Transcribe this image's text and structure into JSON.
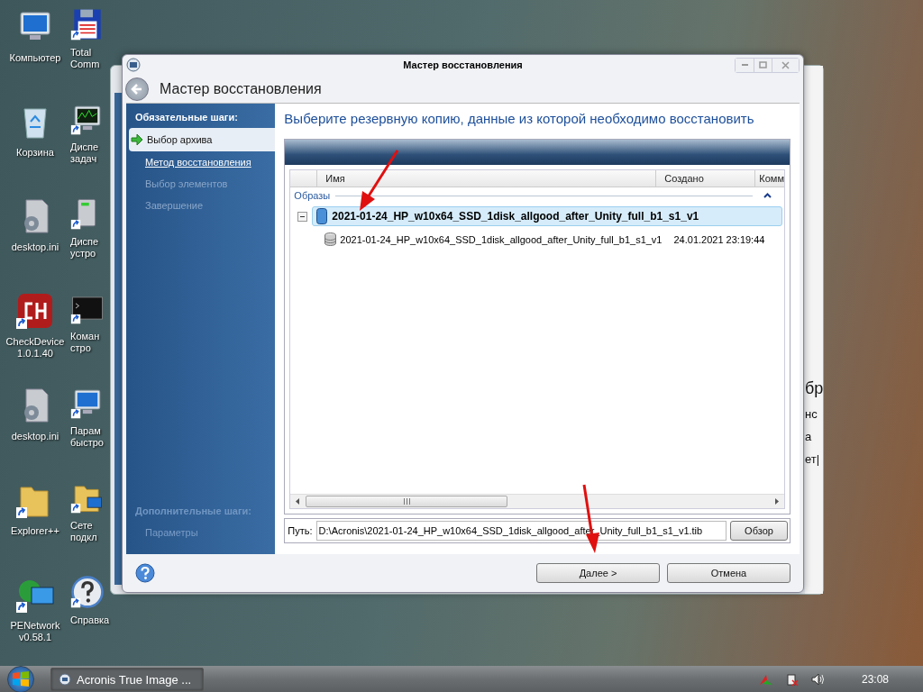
{
  "desktop_columns": [
    {
      "icons": [
        {
          "label": "Компьютер",
          "kind": "computer",
          "shortcut": false
        },
        {
          "label": "Корзина",
          "kind": "recycle-bin",
          "shortcut": false
        },
        {
          "label": "desktop.ini",
          "kind": "settings-file",
          "shortcut": false
        },
        {
          "label": "CheckDevice 1.0.1.40",
          "kind": "ch-logo",
          "shortcut": true
        },
        {
          "label": "desktop.ini",
          "kind": "settings-file",
          "shortcut": false
        },
        {
          "label": "Explorer++",
          "kind": "folder",
          "shortcut": true
        },
        {
          "label": "PENetwork v0.58.1",
          "kind": "globe-monitor",
          "shortcut": true
        }
      ]
    },
    {
      "icons": [
        {
          "label": "Total\nComm",
          "kind": "floppy",
          "shortcut": true
        },
        {
          "label": "Диспе\nзадач",
          "kind": "monitor-chart",
          "shortcut": true
        },
        {
          "label": "Диспе\nустро",
          "kind": "device",
          "shortcut": true
        },
        {
          "label": "Коман\nстро",
          "kind": "console",
          "shortcut": true
        },
        {
          "label": "Парам\nбыстро",
          "kind": "monitor",
          "shortcut": true
        },
        {
          "label": "Сете\nподкл",
          "kind": "folder-network",
          "shortcut": true
        },
        {
          "label": "Справка",
          "kind": "help",
          "shortcut": true
        }
      ]
    }
  ],
  "background_window": {
    "fragments": [
      "бр",
      "нс",
      "а",
      "ет|"
    ]
  },
  "window": {
    "title": "Мастер восстановления",
    "header": "Мастер восстановления",
    "sidebar": {
      "required_title": "Обязательные шаги:",
      "steps": [
        {
          "label": "Выбор архива",
          "selected": true,
          "disabled": false
        },
        {
          "label": "Метод восстановления",
          "selected": false,
          "disabled": false
        },
        {
          "label": "Выбор элементов",
          "selected": false,
          "disabled": true
        },
        {
          "label": "Завершение",
          "selected": false,
          "disabled": true
        }
      ],
      "optional_title": "Дополнительные шаги:",
      "optional_steps": [
        {
          "label": "Параметры",
          "selected": false,
          "disabled": true
        }
      ]
    },
    "heading": "Выберите резервную копию, данные из которой необходимо восстановить",
    "table": {
      "columns": [
        "Имя",
        "Создано",
        "Комм"
      ],
      "group": "Образы",
      "rows": [
        {
          "name": "2021-01-24_HP_w10x64_SSD_1disk_allgood_after_Unity_full_b1_s1_v1",
          "selected": true,
          "expanded": true,
          "children": [
            {
              "name": "2021-01-24_HP_w10x64_SSD_1disk_allgood_after_Unity_full_b1_s1_v1",
              "created": "24.01.2021 23:19:44",
              "selected": false
            }
          ]
        }
      ]
    },
    "path_label": "Путь:",
    "path_value": "D:\\Acronis\\2021-01-24_HP_w10x64_SSD_1disk_allgood_after_Unity_full_b1_s1_v1.tib",
    "browse_button": "Обзор",
    "buttons": [
      "Далее >",
      "Отмена"
    ]
  },
  "taskbar": {
    "tasks": [
      {
        "label": "Acronis True Image ...",
        "selected": true
      }
    ],
    "time": "23:08"
  }
}
